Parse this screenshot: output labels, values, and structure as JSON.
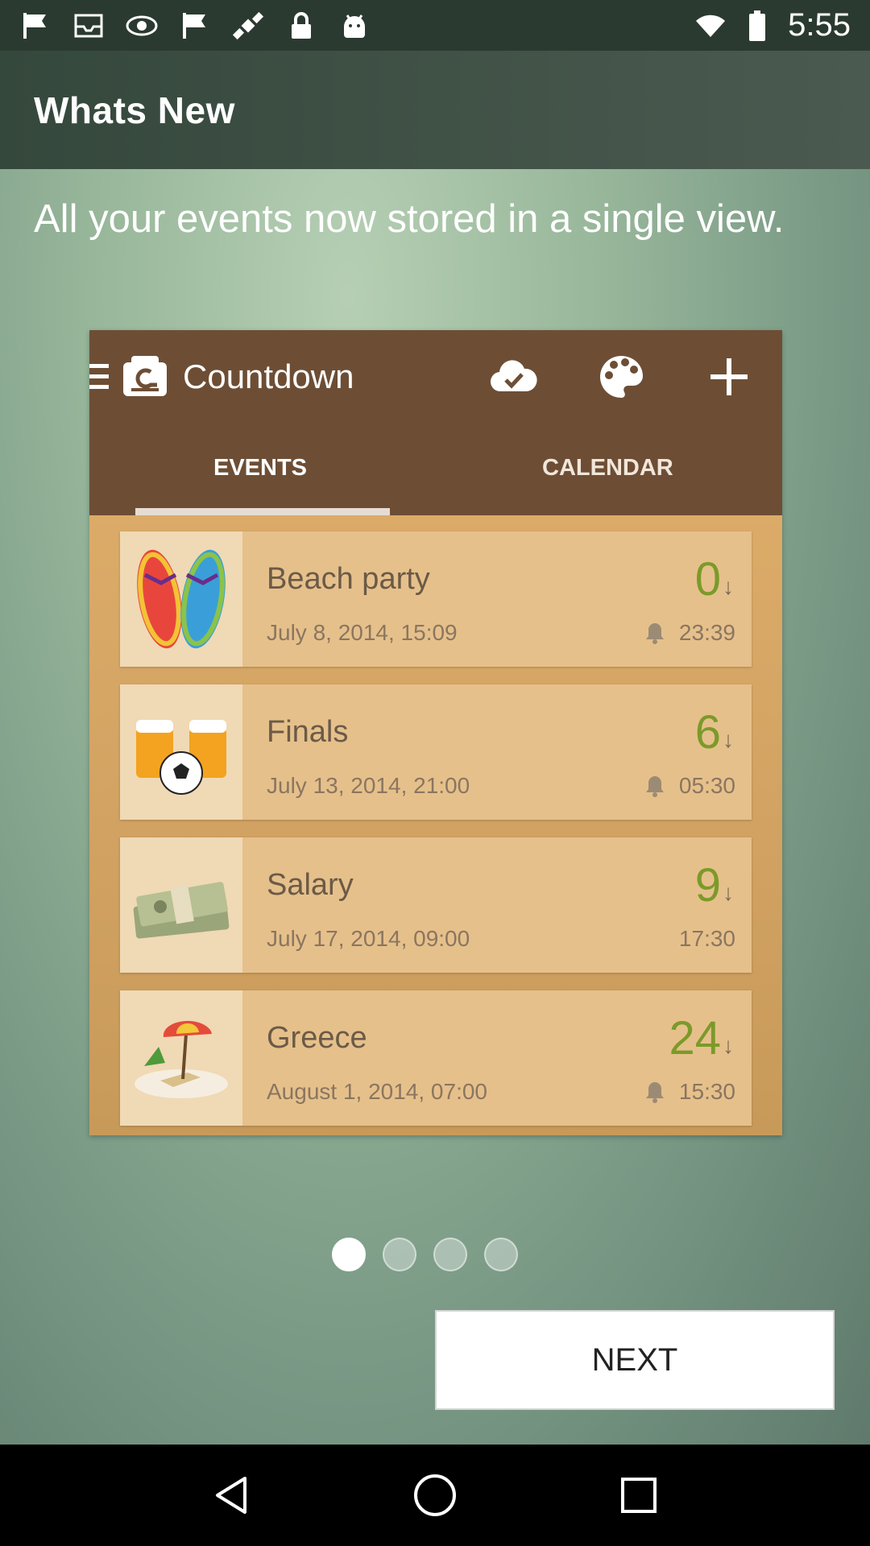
{
  "status_bar": {
    "time": "5:55",
    "icons": [
      "flag-icon",
      "inbox-icon",
      "eye-icon",
      "flag-icon",
      "satellite-icon",
      "lock-icon",
      "android-icon",
      "wifi-icon",
      "battery-icon"
    ]
  },
  "app_bar": {
    "title": "Whats New"
  },
  "headline": "All your events now stored in a single view.",
  "preview": {
    "app_title": "Countdown",
    "tabs": [
      "EVENTS",
      "CALENDAR"
    ],
    "events": [
      {
        "title": "Beach party",
        "date": "July 8, 2014, 15:09",
        "days": "0",
        "arrow": "↓",
        "time": "23:39",
        "has_bell": true,
        "thumb": "flip-flops-icon"
      },
      {
        "title": "Finals",
        "date": "July 13, 2014, 21:00",
        "days": "6",
        "arrow": "↓",
        "time": "05:30",
        "has_bell": true,
        "thumb": "beer-soccer-icon"
      },
      {
        "title": "Salary",
        "date": "July 17, 2014, 09:00",
        "days": "9",
        "arrow": "↓",
        "time": "17:30",
        "has_bell": false,
        "thumb": "money-icon"
      },
      {
        "title": "Greece",
        "date": "August 1, 2014, 07:00",
        "days": "24",
        "arrow": "↓",
        "time": "15:30",
        "has_bell": true,
        "thumb": "beach-umbrella-icon"
      }
    ]
  },
  "pager": {
    "count": 4,
    "active": 0
  },
  "next_label": "NEXT",
  "colors": {
    "accent_days": "#7b9a2a",
    "toolbar": "#6d4e35"
  }
}
